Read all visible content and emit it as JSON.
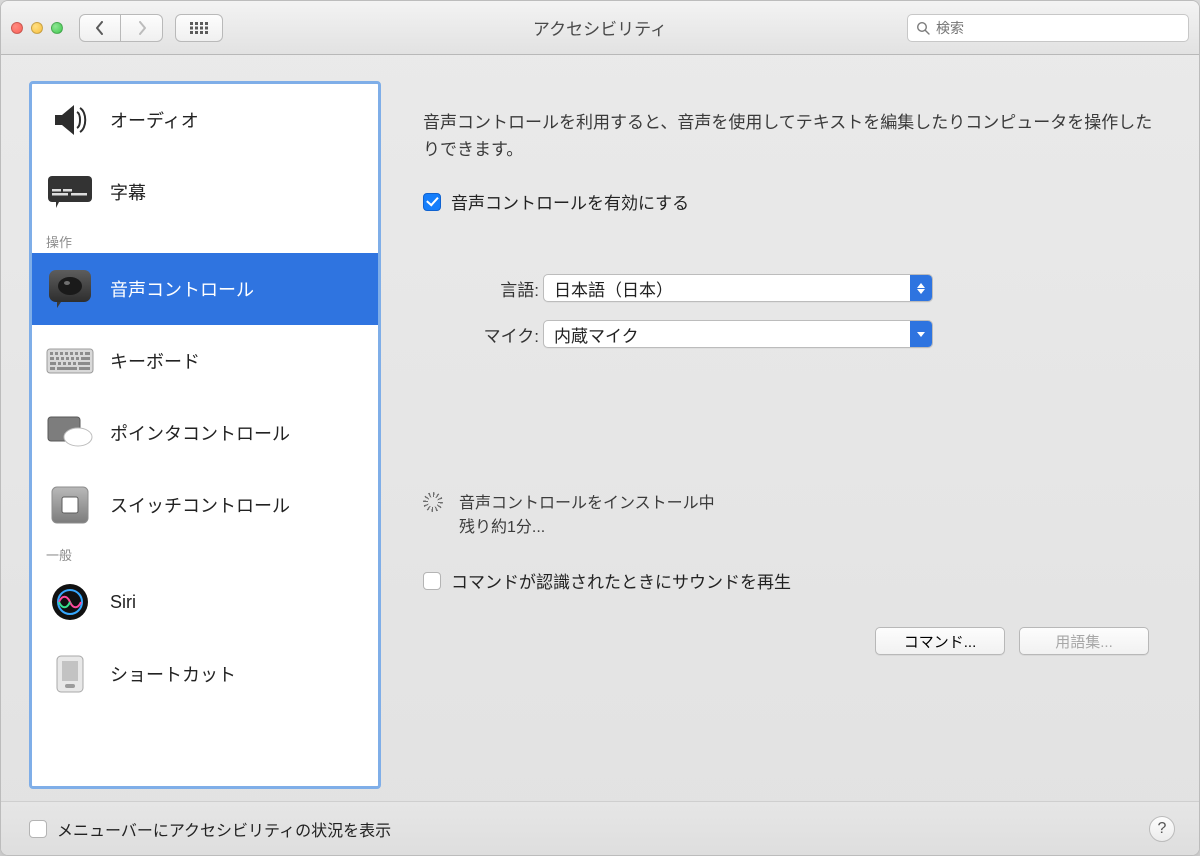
{
  "window": {
    "title": "アクセシビリティ",
    "search_placeholder": "検索"
  },
  "sidebar": {
    "items": [
      {
        "label": "オーディオ",
        "icon": "speaker"
      },
      {
        "label": "字幕",
        "icon": "captions"
      }
    ],
    "section1": "操作",
    "items2": [
      {
        "label": "音声コントロール",
        "selected": true,
        "icon": "voice"
      },
      {
        "label": "キーボード",
        "icon": "keyboard"
      },
      {
        "label": "ポインタコントロール",
        "icon": "pointer"
      },
      {
        "label": "スイッチコントロール",
        "icon": "switch"
      }
    ],
    "section2": "一般",
    "items3": [
      {
        "label": "Siri",
        "icon": "siri"
      },
      {
        "label": "ショートカット",
        "icon": "shortcut"
      }
    ]
  },
  "panel": {
    "desc": "音声コントロールを利用すると、音声を使用してテキストを編集したりコンピュータを操作したりできます。",
    "enable_label": "音声コントロールを有効にする",
    "enable_checked": true,
    "language_label": "言語:",
    "language_value": "日本語（日本）",
    "mic_label": "マイク:",
    "mic_value": "内蔵マイク",
    "install_line1": "音声コントロールをインストール中",
    "install_line2": "残り約1分...",
    "sound_label": "コマンドが認識されたときにサウンドを再生",
    "sound_checked": false,
    "btn_commands": "コマンド...",
    "btn_vocab": "用語集..."
  },
  "footer": {
    "menubar_label": "メニューバーにアクセシビリティの状況を表示",
    "menubar_checked": false
  }
}
